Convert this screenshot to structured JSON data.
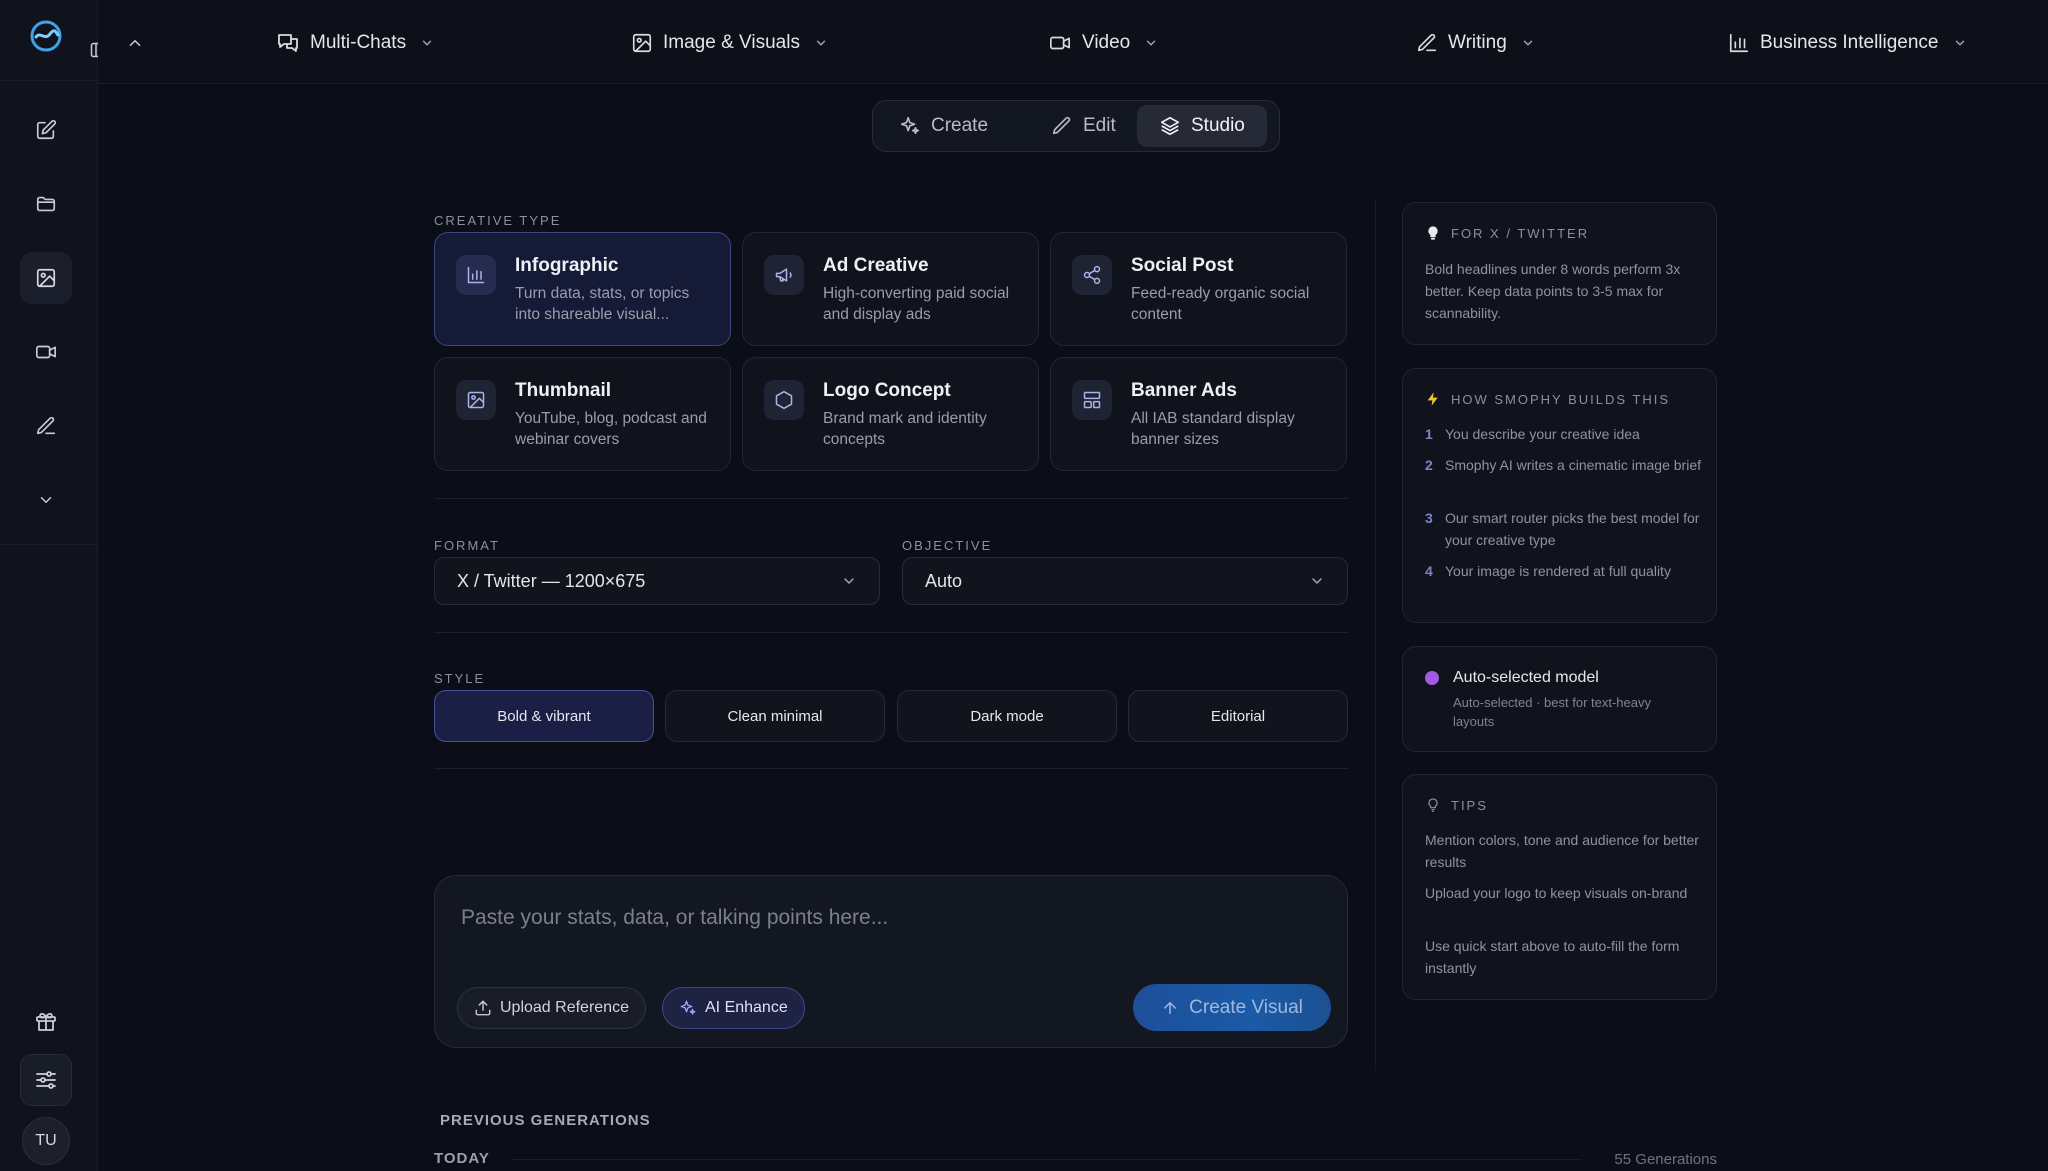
{
  "user": {
    "initials": "TU"
  },
  "topnav": {
    "items": [
      {
        "label": "Multi-Chats",
        "icon": "chat-bubbles-icon"
      },
      {
        "label": "Image & Visuals",
        "icon": "image-icon"
      },
      {
        "label": "Video",
        "icon": "video-icon"
      },
      {
        "label": "Writing",
        "icon": "pen-icon"
      },
      {
        "label": "Business Intelligence",
        "icon": "bar-chart-icon"
      }
    ]
  },
  "modes": {
    "items": [
      {
        "label": "Create",
        "icon": "sparkle-icon"
      },
      {
        "label": "Edit",
        "icon": "pencil-icon"
      },
      {
        "label": "Studio",
        "icon": "layers-icon"
      }
    ],
    "active": "Studio"
  },
  "creative_type": {
    "label": "CREATIVE TYPE",
    "cards": [
      {
        "title": "Infographic",
        "desc": "Turn data, stats, or topics into shareable visual...",
        "icon": "bar-chart-icon",
        "selected": true
      },
      {
        "title": "Ad Creative",
        "desc": "High-converting paid social and display ads",
        "icon": "megaphone-icon"
      },
      {
        "title": "Social Post",
        "desc": "Feed-ready organic social content",
        "icon": "share-icon"
      },
      {
        "title": "Thumbnail",
        "desc": "YouTube, blog, podcast and webinar covers",
        "icon": "image-icon"
      },
      {
        "title": "Logo Concept",
        "desc": "Brand mark and identity concepts",
        "icon": "hexagon-icon"
      },
      {
        "title": "Banner Ads",
        "desc": "All IAB standard display banner sizes",
        "icon": "layout-icon"
      }
    ]
  },
  "format": {
    "label": "FORMAT",
    "value": "X / Twitter — 1200×675"
  },
  "objective": {
    "label": "OBJECTIVE",
    "value": "Auto"
  },
  "style": {
    "label": "STYLE",
    "options": [
      "Bold & vibrant",
      "Clean minimal",
      "Dark mode",
      "Editorial"
    ],
    "selected": "Bold & vibrant"
  },
  "composer": {
    "placeholder": "Paste your stats, data, or talking points here...",
    "upload_label": "Upload Reference",
    "enhance_label": "AI Enhance",
    "create_label": "Create Visual"
  },
  "previous": {
    "label": "PREVIOUS GENERATIONS",
    "group": "TODAY",
    "count": "55 Generations"
  },
  "panels": {
    "twitter": {
      "title": "FOR X / TWITTER",
      "text": "Bold headlines under 8 words perform 3x better. Keep data points to 3-5 max for scannability."
    },
    "builds": {
      "title": "HOW SMOPHY BUILDS THIS",
      "steps": [
        "You describe your creative idea",
        "Smophy AI writes a cinematic image brief",
        "Our smart router picks the best model for your creative type",
        "Your image is rendered at full quality"
      ]
    },
    "model": {
      "title": "Auto-selected model",
      "sub": "Auto-selected · best for text-heavy layouts",
      "dot_color": "#a55ae6"
    },
    "tips": {
      "title": "TIPS",
      "items": [
        "Mention colors, tone and audience for better results",
        "Upload your logo to keep visuals on-brand",
        "Use quick start above to auto-fill the form instantly"
      ]
    }
  },
  "colors": {
    "accent": "#3c4684",
    "primary_button": "#1b5aa6",
    "background": "#0b0e16"
  }
}
